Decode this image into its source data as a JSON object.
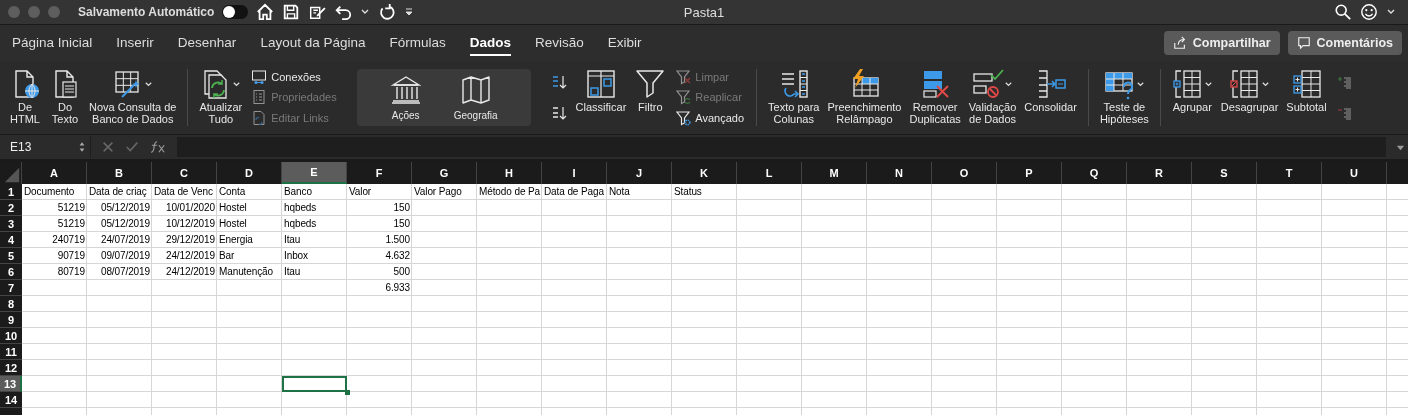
{
  "title_bar": {
    "autosave_label": "Salvamento Automático",
    "autosave_on": false,
    "title": "Pasta1"
  },
  "tabs": [
    {
      "label": "Página Inicial",
      "selected": false
    },
    {
      "label": "Inserir",
      "selected": false
    },
    {
      "label": "Desenhar",
      "selected": false
    },
    {
      "label": "Layout da Página",
      "selected": false
    },
    {
      "label": "Fórmulas",
      "selected": false
    },
    {
      "label": "Dados",
      "selected": true
    },
    {
      "label": "Revisão",
      "selected": false
    },
    {
      "label": "Exibir",
      "selected": false
    }
  ],
  "share_buttons": [
    "Compartilhar",
    "Comentários"
  ],
  "ribbon": {
    "groups": [
      {
        "kind": "plain",
        "items": [
          {
            "kind": "large",
            "lines": [
              "De",
              "HTML"
            ],
            "caret": false
          },
          {
            "kind": "large",
            "lines": [
              "Do",
              "Texto"
            ],
            "caret": false
          },
          {
            "kind": "large",
            "lines": [
              "Nova Consulta de",
              "Banco de Dados"
            ],
            "caret": true
          }
        ]
      },
      {
        "kind": "plain",
        "items": [
          {
            "kind": "large",
            "lines": [
              "Atualizar",
              "Tudo"
            ],
            "caret": true
          },
          {
            "kind": "stack",
            "items": [
              {
                "label": "Conexões",
                "disabled": false
              },
              {
                "label": "Propriedades",
                "disabled": true
              },
              {
                "label": "Editar Links",
                "disabled": true
              }
            ]
          }
        ]
      },
      {
        "kind": "gallery",
        "items": [
          {
            "kind": "large",
            "lines": [
              "Ações"
            ],
            "caret": false
          },
          {
            "kind": "large",
            "lines": [
              "Geografia"
            ],
            "caret": false
          }
        ]
      },
      {
        "kind": "plain",
        "items": [
          {
            "kind": "stack",
            "items": [
              {
                "disabled": false
              },
              {
                "disabled": false
              }
            ]
          },
          {
            "kind": "large",
            "lines": [
              "Classificar"
            ],
            "caret": false
          },
          {
            "kind": "large",
            "lines": [
              "Filtro"
            ],
            "caret": false
          },
          {
            "kind": "stack",
            "items": [
              {
                "label": "Limpar",
                "disabled": true
              },
              {
                "label": "Reaplicar",
                "disabled": true
              },
              {
                "label": "Avançado",
                "disabled": false
              }
            ]
          }
        ]
      },
      {
        "kind": "plain",
        "items": [
          {
            "kind": "large",
            "lines": [
              "Texto para",
              "Colunas"
            ],
            "caret": false
          },
          {
            "kind": "large",
            "lines": [
              "Preenchimento",
              "Relâmpago"
            ],
            "caret": false
          },
          {
            "kind": "large",
            "lines": [
              "Remover",
              "Duplicatas"
            ],
            "caret": false
          },
          {
            "kind": "large",
            "lines": [
              "Validação",
              "de Dados"
            ],
            "caret": true
          },
          {
            "kind": "large",
            "lines": [
              "Consolidar"
            ],
            "caret": false
          }
        ]
      },
      {
        "kind": "plain",
        "items": [
          {
            "kind": "large",
            "lines": [
              "Teste de",
              "Hipóteses"
            ],
            "caret": true
          }
        ]
      },
      {
        "kind": "plain",
        "items": [
          {
            "kind": "large",
            "lines": [
              "Agrupar"
            ],
            "caret": true
          },
          {
            "kind": "large",
            "lines": [
              "Desagrupar"
            ],
            "caret": true
          },
          {
            "kind": "large",
            "lines": [
              "Subtotal"
            ],
            "caret": false
          },
          {
            "kind": "stack",
            "items": [
              {
                "disabled": true
              },
              {
                "disabled": true
              }
            ]
          }
        ]
      }
    ]
  },
  "formula_bar": {
    "name_box": "E13"
  },
  "sheet": {
    "columns": [
      {
        "label": "A",
        "selected": false
      },
      {
        "label": "B",
        "selected": false
      },
      {
        "label": "C",
        "selected": false
      },
      {
        "label": "D",
        "selected": false
      },
      {
        "label": "E",
        "selected": true
      },
      {
        "label": "F",
        "selected": false
      },
      {
        "label": "G",
        "selected": false
      },
      {
        "label": "H",
        "selected": false
      },
      {
        "label": "I",
        "selected": false
      },
      {
        "label": "J",
        "selected": false
      },
      {
        "label": "K",
        "selected": false
      },
      {
        "label": "L",
        "selected": false
      },
      {
        "label": "M",
        "selected": false
      },
      {
        "label": "N",
        "selected": false
      },
      {
        "label": "O",
        "selected": false
      },
      {
        "label": "P",
        "selected": false
      },
      {
        "label": "Q",
        "selected": false
      },
      {
        "label": "R",
        "selected": false
      },
      {
        "label": "S",
        "selected": false
      },
      {
        "label": "T",
        "selected": false
      },
      {
        "label": "U",
        "selected": false
      }
    ],
    "rows": [
      {
        "label": "1",
        "selected": false,
        "cells": [
          {
            "text": "Documento",
            "kind": "text"
          },
          {
            "text": "Data de criaç",
            "kind": "text"
          },
          {
            "text": "Data de Venc",
            "kind": "text"
          },
          {
            "text": "Conta",
            "kind": "text"
          },
          {
            "text": "Banco",
            "kind": "text"
          },
          {
            "text": "Valor",
            "kind": "text"
          },
          {
            "text": "Valor Pago",
            "kind": "text"
          },
          {
            "text": "Método de Pa",
            "kind": "text"
          },
          {
            "text": "Data de Paga",
            "kind": "text"
          },
          {
            "text": "Nota",
            "kind": "text"
          },
          {
            "text": "Status",
            "kind": "text"
          }
        ]
      },
      {
        "label": "2",
        "selected": false,
        "cells": [
          {
            "text": "51219",
            "kind": "number"
          },
          {
            "text": "05/12/2019",
            "kind": "number"
          },
          {
            "text": "10/01/2020",
            "kind": "number"
          },
          {
            "text": "Hostel",
            "kind": "text"
          },
          {
            "text": "hqbeds",
            "kind": "text"
          },
          {
            "text": "150",
            "kind": "number"
          }
        ]
      },
      {
        "label": "3",
        "selected": false,
        "cells": [
          {
            "text": "51219",
            "kind": "number"
          },
          {
            "text": "05/12/2019",
            "kind": "number"
          },
          {
            "text": "10/12/2019",
            "kind": "number"
          },
          {
            "text": "Hostel",
            "kind": "text"
          },
          {
            "text": "hqbeds",
            "kind": "text"
          },
          {
            "text": "150",
            "kind": "number"
          }
        ]
      },
      {
        "label": "4",
        "selected": false,
        "cells": [
          {
            "text": "240719",
            "kind": "number"
          },
          {
            "text": "24/07/2019",
            "kind": "number"
          },
          {
            "text": "29/12/2019",
            "kind": "number"
          },
          {
            "text": "Energia",
            "kind": "text"
          },
          {
            "text": "Itau",
            "kind": "text"
          },
          {
            "text": "1.500",
            "kind": "number"
          }
        ]
      },
      {
        "label": "5",
        "selected": false,
        "cells": [
          {
            "text": "90719",
            "kind": "number"
          },
          {
            "text": "09/07/2019",
            "kind": "number"
          },
          {
            "text": "24/12/2019",
            "kind": "number"
          },
          {
            "text": "Bar",
            "kind": "text"
          },
          {
            "text": "Inbox",
            "kind": "text"
          },
          {
            "text": "4.632",
            "kind": "number"
          }
        ]
      },
      {
        "label": "6",
        "selected": false,
        "cells": [
          {
            "text": "80719",
            "kind": "number"
          },
          {
            "text": "08/07/2019",
            "kind": "number"
          },
          {
            "text": "24/12/2019",
            "kind": "number"
          },
          {
            "text": "Manutenção",
            "kind": "text"
          },
          {
            "text": "Itau",
            "kind": "text"
          },
          {
            "text": "500",
            "kind": "number"
          }
        ]
      },
      {
        "label": "7",
        "selected": false,
        "cells": [
          {},
          {},
          {},
          {},
          {},
          {
            "text": "6.933",
            "kind": "number"
          }
        ]
      },
      {
        "label": "8",
        "selected": false,
        "cells": []
      },
      {
        "label": "9",
        "selected": false,
        "cells": []
      },
      {
        "label": "10",
        "selected": false,
        "cells": []
      },
      {
        "label": "11",
        "selected": false,
        "cells": []
      },
      {
        "label": "12",
        "selected": false,
        "cells": []
      },
      {
        "label": "13",
        "selected": true,
        "cells": []
      },
      {
        "label": "14",
        "selected": false,
        "cells": []
      }
    ]
  }
}
